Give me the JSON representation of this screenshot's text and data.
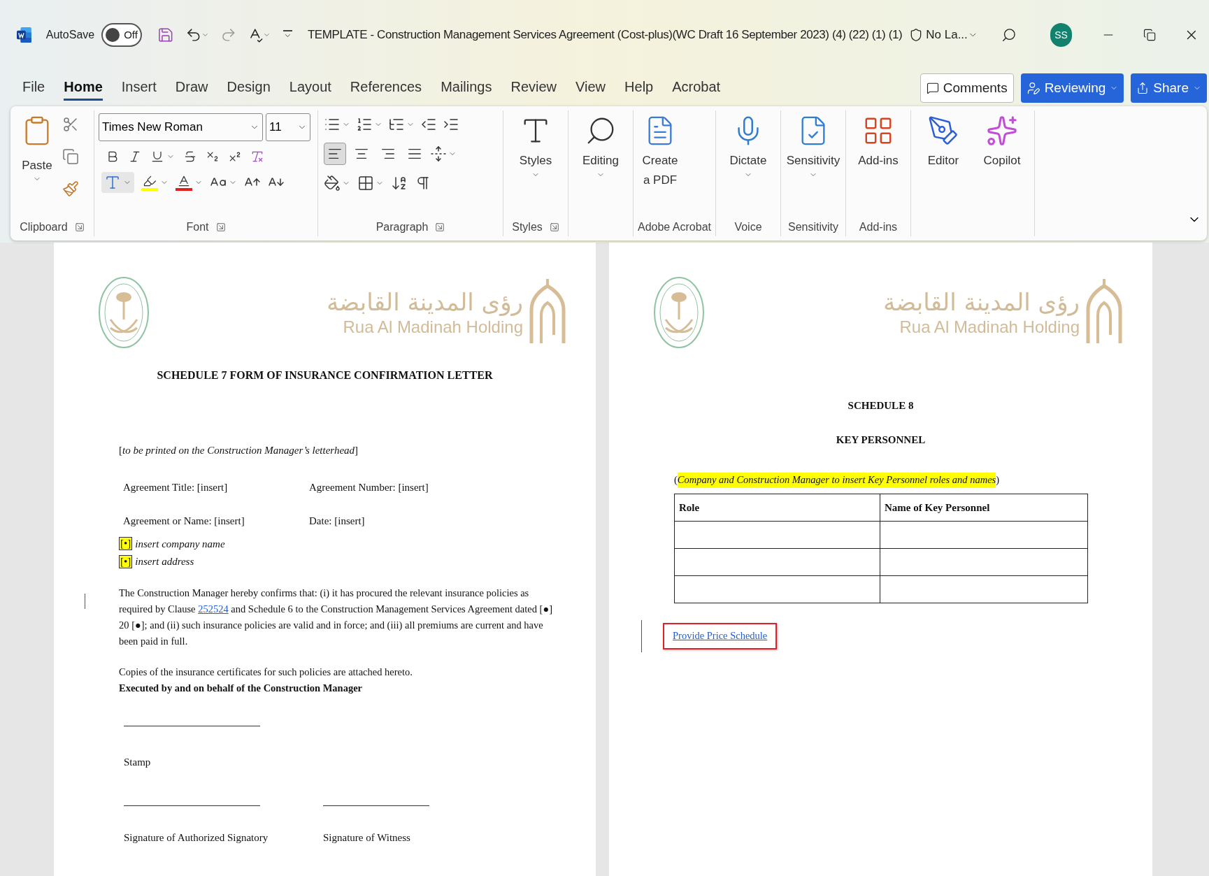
{
  "title_bar": {
    "autosave": {
      "label": "AutoSave",
      "toggle_text": "Off",
      "on": false
    },
    "document_title": "TEMPLATE - Construction Management Services Agreement (Cost-plus)(WC Draft 16 September 2023) (4) (22) (1) (1)",
    "sensitivity": "No La...",
    "avatar": "SS"
  },
  "menu_tabs": [
    {
      "label": "File",
      "selected": false
    },
    {
      "label": "Home",
      "selected": true
    },
    {
      "label": "Insert",
      "selected": false
    },
    {
      "label": "Draw",
      "selected": false
    },
    {
      "label": "Design",
      "selected": false
    },
    {
      "label": "Layout",
      "selected": false
    },
    {
      "label": "References",
      "selected": false
    },
    {
      "label": "Mailings",
      "selected": false
    },
    {
      "label": "Review",
      "selected": false
    },
    {
      "label": "View",
      "selected": false
    },
    {
      "label": "Help",
      "selected": false
    },
    {
      "label": "Acrobat",
      "selected": false
    }
  ],
  "header_buttons": [
    {
      "kind": "comments",
      "label": "Comments"
    },
    {
      "kind": "reviewing",
      "label": "Reviewing"
    },
    {
      "kind": "share",
      "label": "Share"
    }
  ],
  "ribbon": {
    "paste": "Paste",
    "font_name": "Times New Roman",
    "font_size": "11",
    "alignment": [
      {
        "kind": "left",
        "selected": true
      },
      {
        "kind": "center",
        "selected": false
      },
      {
        "kind": "right",
        "selected": false
      },
      {
        "kind": "justify",
        "selected": false
      }
    ],
    "groups": [
      {
        "kind": "clipboard",
        "label": "Clipboard",
        "launcher": true
      },
      {
        "kind": "font",
        "label": "Font",
        "launcher": true
      },
      {
        "kind": "paragraph",
        "label": "Paragraph",
        "launcher": true
      },
      {
        "kind": "buttons",
        "label": "Styles",
        "launcher": true,
        "buttons": [
          {
            "kind": "styles",
            "label": "Styles",
            "dropdown": true
          }
        ]
      },
      {
        "kind": "buttons",
        "buttons": [
          {
            "kind": "editing",
            "label": "Editing",
            "dropdown": true
          }
        ]
      },
      {
        "kind": "buttons",
        "label": "Adobe Acrobat",
        "buttons": [
          {
            "kind": "pdf",
            "label": "Create a PDF",
            "dropdown": false
          }
        ]
      },
      {
        "kind": "buttons",
        "label": "Voice",
        "buttons": [
          {
            "kind": "dictate",
            "label": "Dictate",
            "dropdown": true
          }
        ]
      },
      {
        "kind": "buttons",
        "label": "Sensitivity",
        "buttons": [
          {
            "kind": "sensitivity",
            "label": "Sensitivity",
            "dropdown": true
          }
        ]
      },
      {
        "kind": "buttons",
        "label": "Add-ins",
        "buttons": [
          {
            "kind": "addins",
            "label": "Add-ins",
            "dropdown": false
          }
        ]
      },
      {
        "kind": "buttons",
        "buttons": [
          {
            "kind": "editor",
            "label": "Editor",
            "dropdown": false
          },
          {
            "kind": "copilot",
            "label": "Copilot",
            "dropdown": false
          }
        ]
      }
    ]
  },
  "left_page": {
    "logo_arabic": "رؤى المدينة القابضة",
    "logo_english": "Rua Al Madinah Holding",
    "heading": "SCHEDULE 7 FORM OF INSURANCE CONFIRMATION LETTER",
    "instruction": "[*to be printed on the Construction Manager’s letterhead*]",
    "fields": [
      {
        "left": "Agreement Title: [insert]",
        "right": "Agreement Number: [insert]"
      },
      {
        "left": "Agreement or Name: [insert]",
        "right": "Date: [insert]"
      }
    ],
    "placeholders": [
      {
        "marker": "[•]",
        "text": "insert company name"
      },
      {
        "marker": "[•]",
        "text": "insert address"
      }
    ],
    "confirmation": {
      "before": "The Construction Manager hereby confirms that: (i) it has procured the relevant insurance policies as required by Clause ",
      "link": "252524",
      "after": " and Schedule 6 to the Construction Management Services Agreement dated [●] 20 [●]; and (ii) such insurance policies are valid and in force; and (iii) all premiums are current and have been paid in full."
    },
    "copies": "Copies of the insurance certificates for such policies are attached hereto.",
    "executed": "Executed by and on behalf of the Construction Manager",
    "stamp": "Stamp",
    "signatures": [
      "Signature of Authorized Signatory",
      "Signature of Witness"
    ]
  },
  "right_page": {
    "logo_arabic": "رؤى المدينة القابضة",
    "logo_english": "Rua Al Madinah Holding",
    "schedule": "SCHEDULE 8",
    "title": "KEY PERSONNEL",
    "instruction": {
      "open": "(",
      "highlighted": "Company and Construction Manager to insert Key Personnel roles and names",
      "close": ")"
    },
    "table": {
      "columns": [
        "Role",
        "Name of Key Personnel"
      ],
      "rows": [
        {
          "kind": "empty"
        },
        {
          "kind": "empty"
        },
        {
          "kind": "empty"
        }
      ]
    },
    "link": "Provide Price Schedule"
  }
}
